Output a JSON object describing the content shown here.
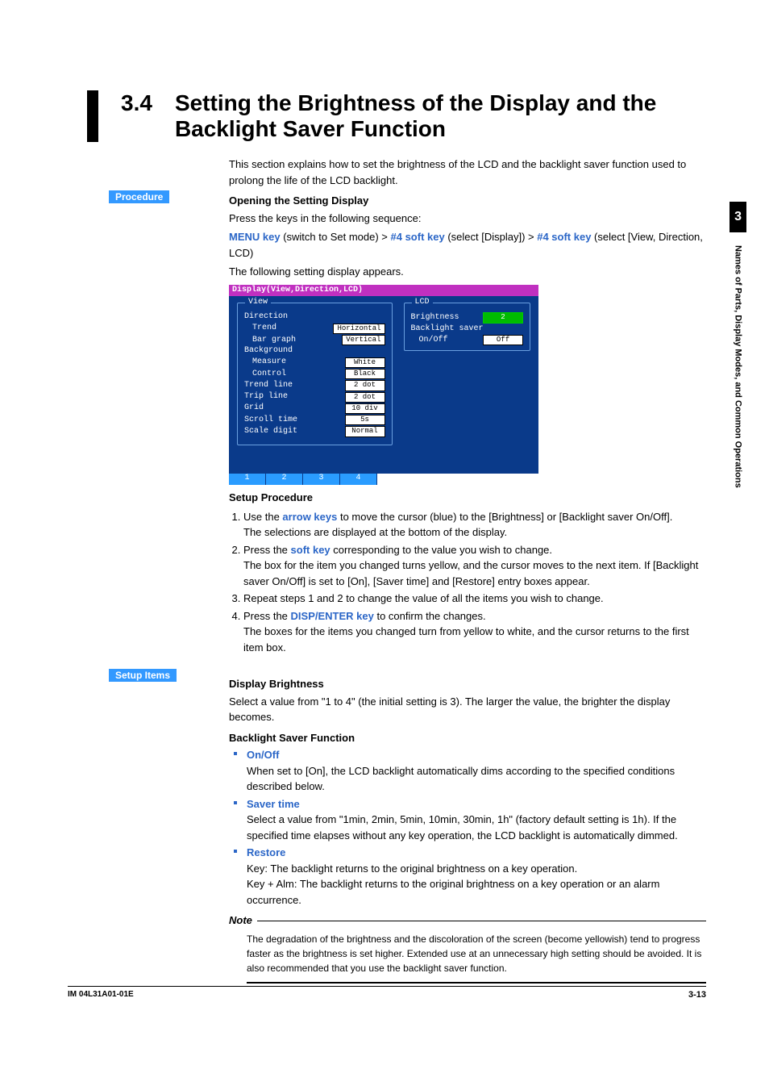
{
  "side_tab": {
    "num": "3",
    "label": "Names of Parts, Display Modes, and Common Operations"
  },
  "header": {
    "num": "3.4",
    "title": "Setting the Brightness of the Display and the Backlight Saver Function"
  },
  "intro": "This section explains how to set the brightness of the LCD and the backlight saver function used to prolong the life of the LCD backlight.",
  "badges": {
    "procedure": "Procedure",
    "setup_items": "Setup Items"
  },
  "opening": {
    "heading": "Opening the Setting Display",
    "line1": "Press the keys in the following sequence:",
    "seq": {
      "k1": "MENU key",
      "t1": " (switch to Set mode) > ",
      "k2": "#4 soft key",
      "t2": " (select [Display]) > ",
      "k3": "#4 soft key",
      "t3": " (select [View, Direction, LCD)"
    },
    "line3": "The following setting display appears."
  },
  "screenshot": {
    "titlebar": "Display(View,Direction,LCD)",
    "left_title": "View",
    "left_rows": [
      {
        "label": "Direction",
        "value": "",
        "indent": 0
      },
      {
        "label": "Trend",
        "value": "Horizontal",
        "indent": 1
      },
      {
        "label": "Bar graph",
        "value": "Vertical",
        "indent": 1
      },
      {
        "label": "Background",
        "value": "",
        "indent": 0
      },
      {
        "label": "Measure",
        "value": "White",
        "indent": 1
      },
      {
        "label": "Control",
        "value": "Black",
        "indent": 1
      },
      {
        "label": "Trend line",
        "value": "2  dot",
        "indent": 0
      },
      {
        "label": "Trip line",
        "value": "2  dot",
        "indent": 0
      },
      {
        "label": "Grid",
        "value": "10 div",
        "indent": 0
      },
      {
        "label": "Scroll time",
        "value": "5s",
        "indent": 0
      },
      {
        "label": "Scale digit",
        "value": "Normal",
        "indent": 0
      }
    ],
    "right_title": "LCD",
    "right_rows": [
      {
        "label": "Brightness",
        "value": "2",
        "green": true
      },
      {
        "label": "Backlight saver",
        "value": ""
      },
      {
        "label": "On/Off",
        "value": "Off",
        "indent": 1
      }
    ],
    "softkeys": [
      "1",
      "2",
      "3",
      "4"
    ]
  },
  "setup_procedure": {
    "heading": "Setup Procedure",
    "steps": [
      {
        "pre": "Use the ",
        "key": "arrow keys",
        "post": " to move the cursor (blue) to the [Brightness] or [Backlight saver On/Off].",
        "sub": "The selections are displayed at the bottom of the display."
      },
      {
        "pre": "Press the ",
        "key": "soft key",
        "post": " corresponding to the value you wish to change.",
        "sub": "The box for the item you changed turns yellow, and the cursor moves to the next item. If [Backlight saver On/Off] is set to [On], [Saver time] and [Restore] entry boxes appear."
      },
      {
        "pre": "Repeat steps 1 and 2 to change the value of all the items you wish to change.",
        "key": "",
        "post": "",
        "sub": ""
      },
      {
        "pre": "Press the ",
        "key": "DISP/ENTER key",
        "post": " to confirm the changes.",
        "sub": "The boxes for the items you changed turn from yellow to white, and the cursor returns to the first item box."
      }
    ]
  },
  "setup_items": {
    "display_brightness": {
      "heading": "Display Brightness",
      "body": "Select a value from \"1 to 4\" (the initial setting is 3).  The larger the value, the brighter the display becomes."
    },
    "backlight_heading": "Backlight Saver Function",
    "bullets": [
      {
        "title": "On/Off",
        "body": "When set to [On], the LCD backlight automatically dims according to the specified conditions described below."
      },
      {
        "title": "Saver time",
        "body": "Select a value from \"1min, 2min, 5min, 10min, 30min, 1h\" (factory default setting is 1h).  If the specified time elapses without any key operation, the LCD backlight is automatically dimmed."
      },
      {
        "title": "Restore",
        "body_lines": [
          "Key: The backlight returns to the original brightness on a key operation.",
          "Key + Alm: The backlight returns to the original brightness on a key operation or an alarm occurrence."
        ]
      }
    ]
  },
  "note": {
    "heading": "Note",
    "body": "The degradation of the brightness and the discoloration of the screen (become yellowish) tend to progress faster as the brightness is set higher. Extended use at an unnecessary high setting should be avoided. It is also recommended that you use the backlight saver function."
  },
  "footer": {
    "docid": "IM 04L31A01-01E",
    "pageno": "3-13"
  }
}
